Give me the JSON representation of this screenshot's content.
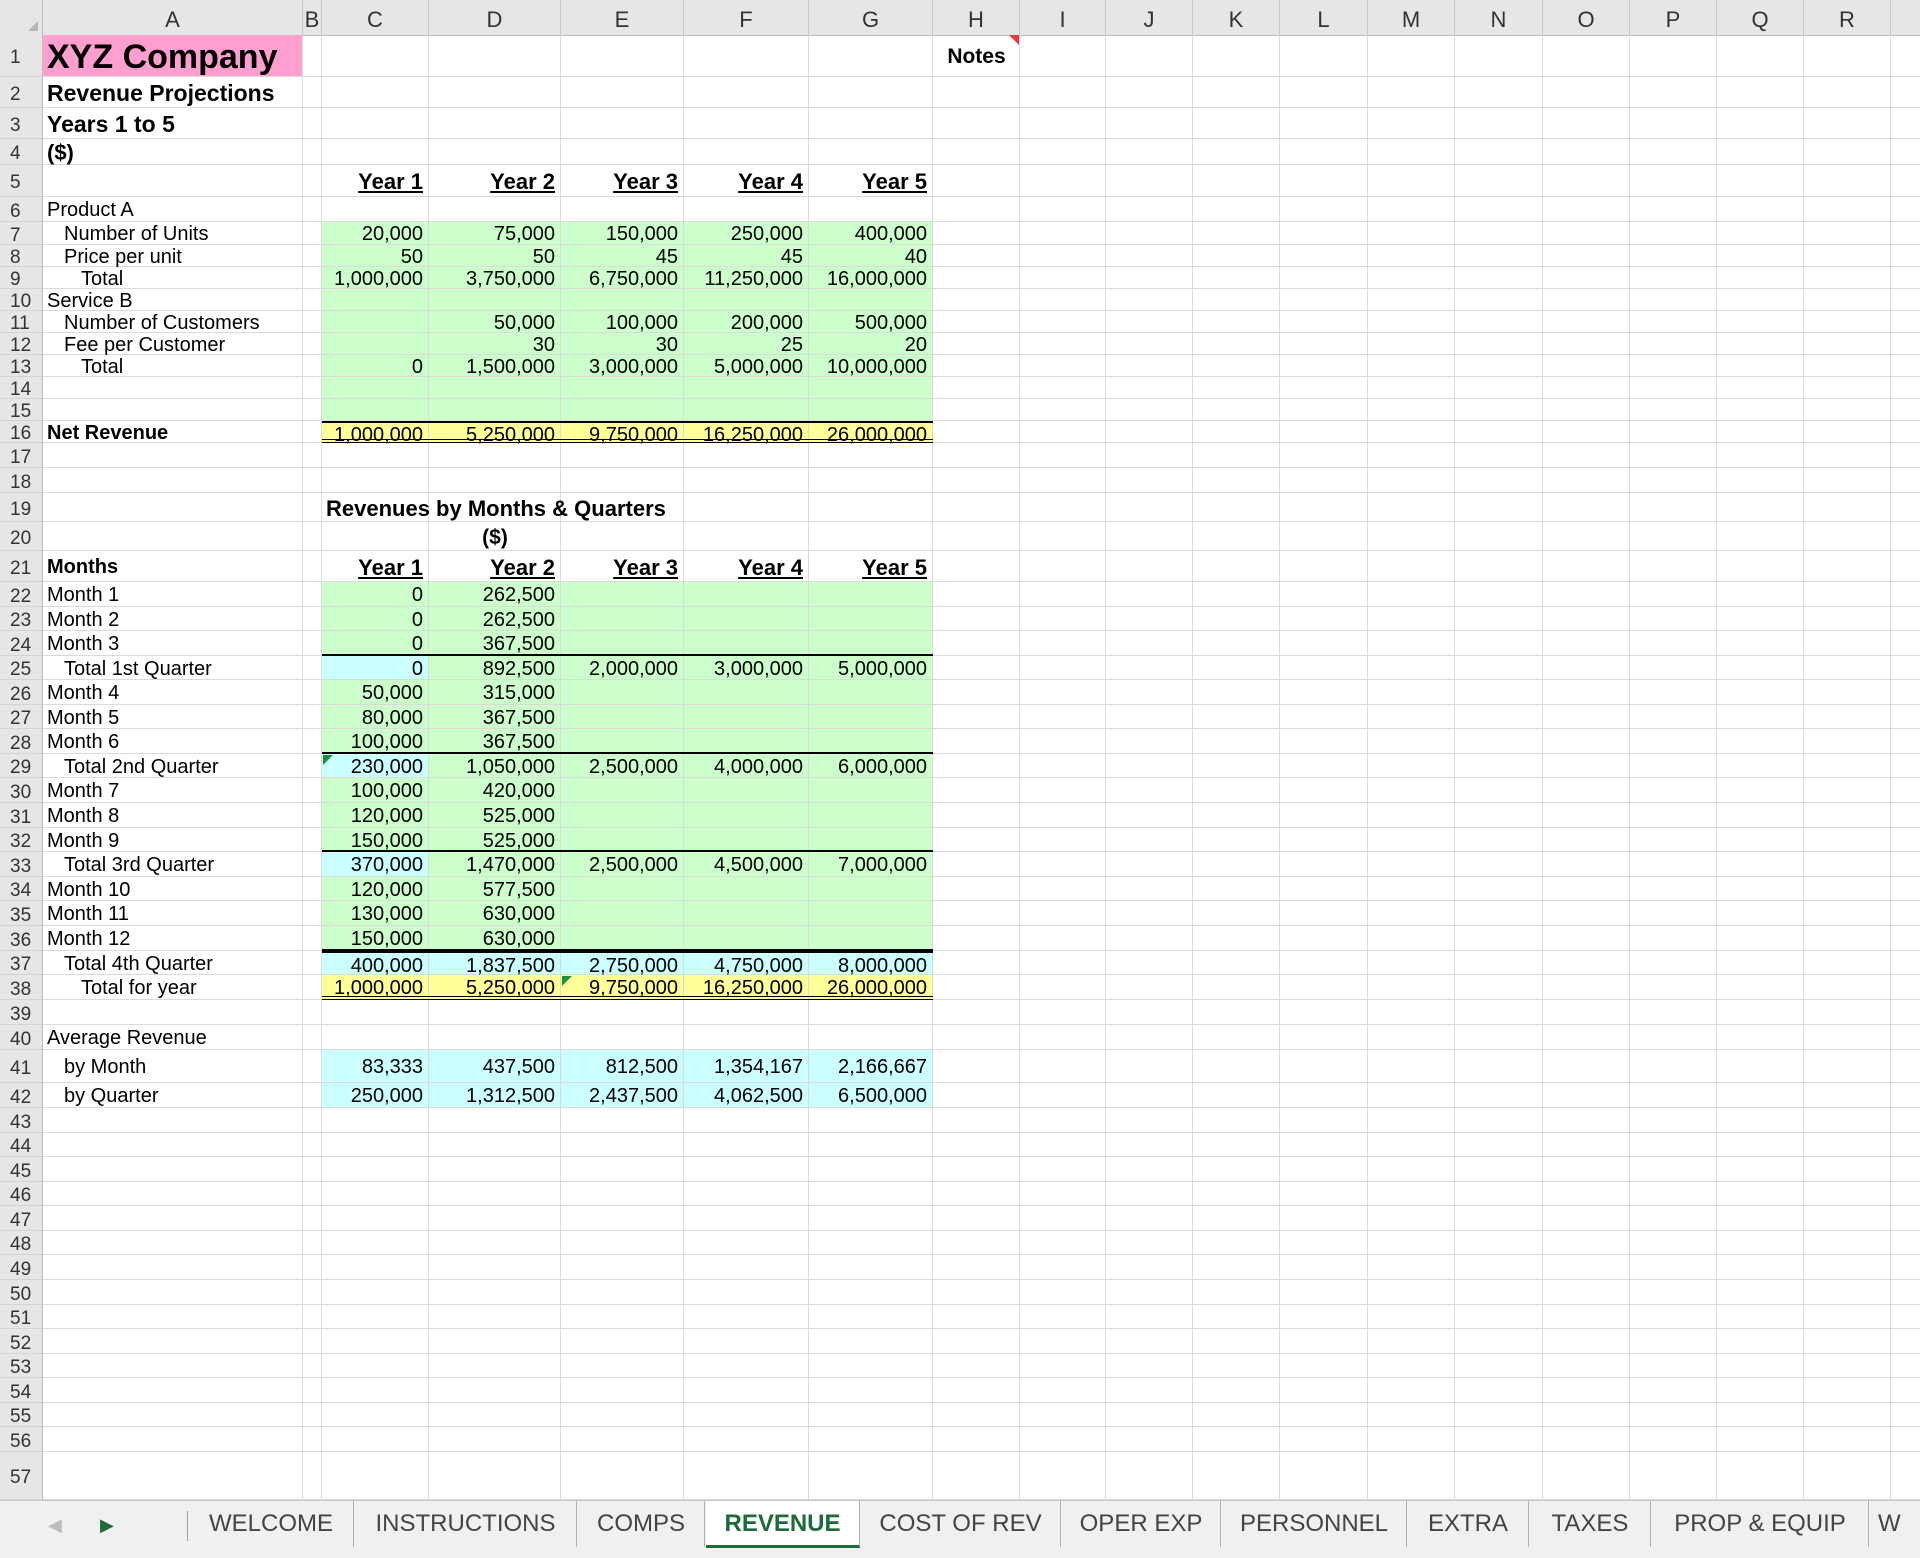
{
  "columns": [
    "A",
    "B",
    "C",
    "D",
    "E",
    "F",
    "G",
    "H",
    "I",
    "J",
    "K",
    "L",
    "M",
    "N",
    "O",
    "P",
    "Q",
    "R"
  ],
  "rows": [
    "1",
    "2",
    "3",
    "4",
    "5",
    "6",
    "7",
    "8",
    "9",
    "10",
    "11",
    "12",
    "13",
    "14",
    "15",
    "16",
    "17",
    "18",
    "19",
    "20",
    "21",
    "22",
    "23",
    "24",
    "25",
    "26",
    "27",
    "28",
    "29",
    "30",
    "31",
    "32",
    "33",
    "34",
    "35",
    "36",
    "37",
    "38",
    "39",
    "40",
    "41",
    "42",
    "43",
    "44",
    "45",
    "46",
    "47",
    "48",
    "49",
    "50",
    "51",
    "52",
    "53",
    "54",
    "55",
    "56",
    "57"
  ],
  "colors": {
    "title_fill": "#ff9fcf",
    "input_fill": "#ccffcc",
    "subtotal_fill": "#ccffff",
    "total_fill": "#ffff99",
    "active_tab": "#1d6b3b"
  },
  "sheet": {
    "title": "XYZ Company",
    "subtitle": "Revenue Projections",
    "period": "Years 1 to 5",
    "units": "($)",
    "notes_header": "Notes",
    "year_headers": [
      "Year 1",
      "Year 2",
      "Year 3",
      "Year 4",
      "Year 5"
    ],
    "section1": [
      {
        "label": "Product A",
        "indent": 0,
        "values": [
          "",
          "",
          "",
          "",
          ""
        ]
      },
      {
        "label": "Number of Units",
        "indent": 1,
        "values": [
          "20,000",
          "75,000",
          "150,000",
          "250,000",
          "400,000"
        ]
      },
      {
        "label": "Price per unit",
        "indent": 1,
        "values": [
          "50",
          "50",
          "45",
          "45",
          "40"
        ]
      },
      {
        "label": "Total",
        "indent": 2,
        "values": [
          "1,000,000",
          "3,750,000",
          "6,750,000",
          "11,250,000",
          "16,000,000"
        ]
      },
      {
        "label": "Service B",
        "indent": 0,
        "values": [
          "",
          "",
          "",
          "",
          ""
        ]
      },
      {
        "label": "Number of Customers",
        "indent": 1,
        "values": [
          "",
          "50,000",
          "100,000",
          "200,000",
          "500,000"
        ]
      },
      {
        "label": "Fee per Customer",
        "indent": 1,
        "values": [
          "",
          "30",
          "30",
          "25",
          "20"
        ]
      },
      {
        "label": "Total",
        "indent": 2,
        "values": [
          "0",
          "1,500,000",
          "3,000,000",
          "5,000,000",
          "10,000,000"
        ]
      }
    ],
    "net_revenue_label": "Net Revenue",
    "net_revenue": [
      "1,000,000",
      "5,250,000",
      "9,750,000",
      "16,250,000",
      "26,000,000"
    ],
    "section2_title": "Revenues by Months & Quarters",
    "section2_units": "($)",
    "months_label": "Months",
    "months": [
      {
        "label": "Month 1",
        "indent": 0,
        "type": "month",
        "values": [
          "0",
          "262,500",
          "",
          "",
          ""
        ]
      },
      {
        "label": "Month 2",
        "indent": 0,
        "type": "month",
        "values": [
          "0",
          "262,500",
          "",
          "",
          ""
        ]
      },
      {
        "label": "Month 3",
        "indent": 0,
        "type": "month",
        "values": [
          "0",
          "367,500",
          "",
          "",
          ""
        ]
      },
      {
        "label": "Total 1st Quarter",
        "indent": 1,
        "type": "quarter",
        "values": [
          "0",
          "892,500",
          "2,000,000",
          "3,000,000",
          "5,000,000"
        ]
      },
      {
        "label": "Month 4",
        "indent": 0,
        "type": "month",
        "values": [
          "50,000",
          "315,000",
          "",
          "",
          ""
        ]
      },
      {
        "label": "Month 5",
        "indent": 0,
        "type": "month",
        "values": [
          "80,000",
          "367,500",
          "",
          "",
          ""
        ]
      },
      {
        "label": "Month 6",
        "indent": 0,
        "type": "month",
        "values": [
          "100,000",
          "367,500",
          "",
          "",
          ""
        ]
      },
      {
        "label": "Total 2nd Quarter",
        "indent": 1,
        "type": "quarter",
        "values": [
          "230,000",
          "1,050,000",
          "2,500,000",
          "4,000,000",
          "6,000,000"
        ]
      },
      {
        "label": "Month 7",
        "indent": 0,
        "type": "month",
        "values": [
          "100,000",
          "420,000",
          "",
          "",
          ""
        ]
      },
      {
        "label": "Month 8",
        "indent": 0,
        "type": "month",
        "values": [
          "120,000",
          "525,000",
          "",
          "",
          ""
        ]
      },
      {
        "label": "Month 9",
        "indent": 0,
        "type": "month",
        "values": [
          "150,000",
          "525,000",
          "",
          "",
          ""
        ]
      },
      {
        "label": "Total 3rd Quarter",
        "indent": 1,
        "type": "quarter",
        "values": [
          "370,000",
          "1,470,000",
          "2,500,000",
          "4,500,000",
          "7,000,000"
        ]
      },
      {
        "label": "Month 10",
        "indent": 0,
        "type": "month",
        "values": [
          "120,000",
          "577,500",
          "",
          "",
          ""
        ]
      },
      {
        "label": "Month 11",
        "indent": 0,
        "type": "month",
        "values": [
          "130,000",
          "630,000",
          "",
          "",
          ""
        ]
      },
      {
        "label": "Month 12",
        "indent": 0,
        "type": "month",
        "values": [
          "150,000",
          "630,000",
          "",
          "",
          ""
        ]
      },
      {
        "label": "Total 4th Quarter",
        "indent": 1,
        "type": "quarter",
        "values": [
          "400,000",
          "1,837,500",
          "2,750,000",
          "4,750,000",
          "8,000,000"
        ]
      },
      {
        "label": "Total for year",
        "indent": 2,
        "type": "year",
        "values": [
          "1,000,000",
          "5,250,000",
          "9,750,000",
          "16,250,000",
          "26,000,000"
        ]
      }
    ],
    "average_label": "Average Revenue",
    "average": [
      {
        "label": "by Month",
        "values": [
          "83,333",
          "437,500",
          "812,500",
          "1,354,167",
          "2,166,667"
        ]
      },
      {
        "label": "by Quarter",
        "values": [
          "250,000",
          "1,312,500",
          "2,437,500",
          "4,062,500",
          "6,500,000"
        ]
      }
    ]
  },
  "tabs": [
    "WELCOME",
    "INSTRUCTIONS",
    "COMPS",
    "REVENUE",
    "COST OF REV",
    "OPER EXP",
    "PERSONNEL",
    "EXTRA",
    "TAXES",
    "PROP & EQUIP",
    "W"
  ],
  "active_tab": "REVENUE"
}
